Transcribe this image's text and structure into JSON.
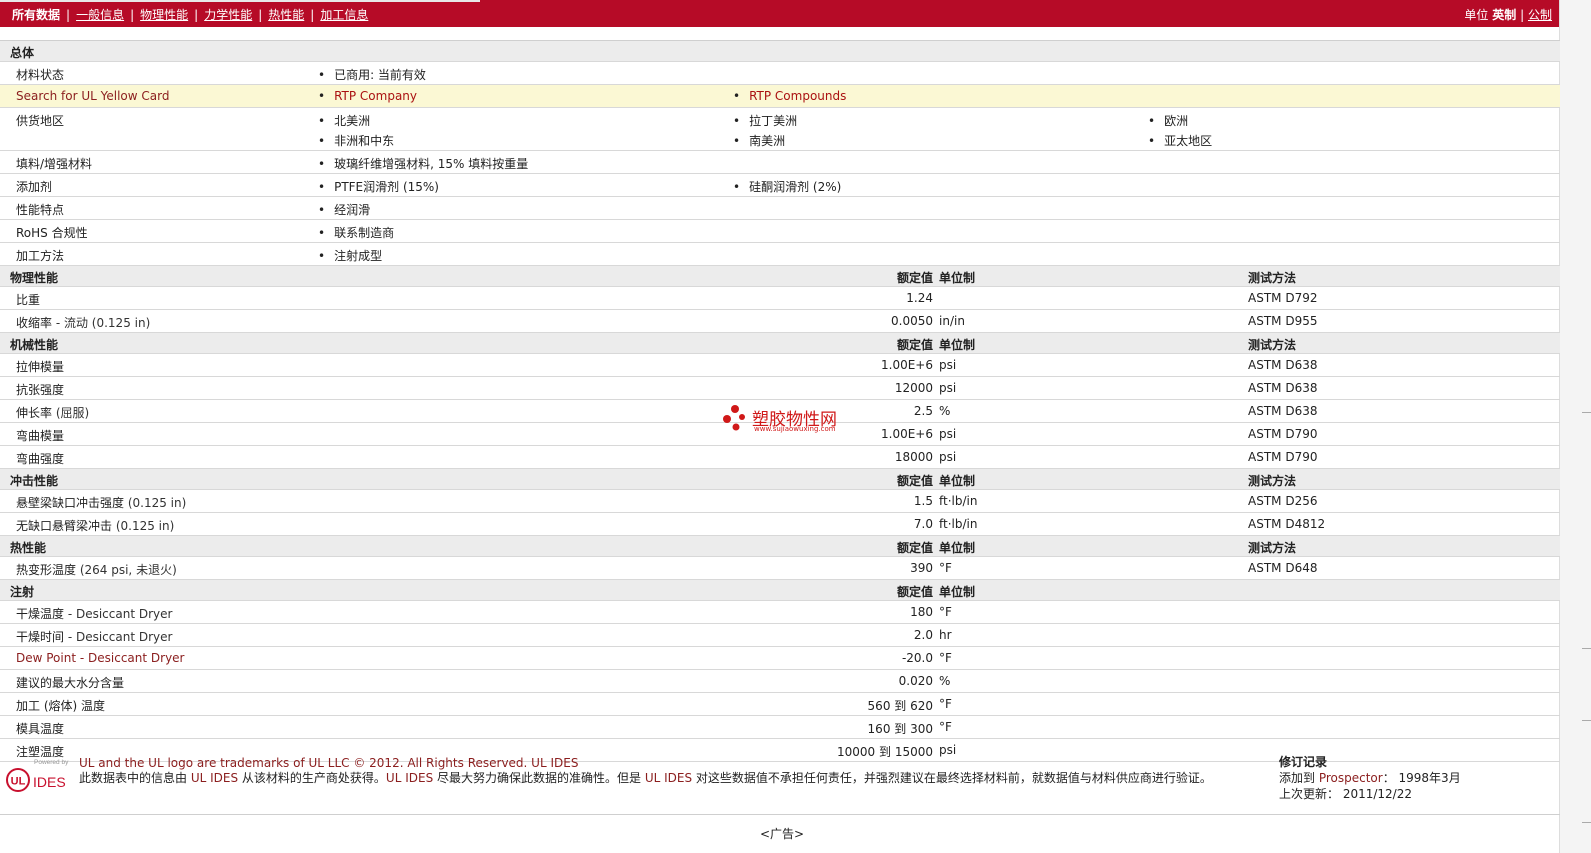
{
  "nav": {
    "all_data": "所有数据",
    "general": "一般信息",
    "physical": "物理性能",
    "mechanical": "力学性能",
    "thermal": "热性能",
    "processing": "加工信息",
    "sep": "|"
  },
  "units": {
    "label": "单位",
    "english": "英制",
    "sep": "|",
    "metric": "公制"
  },
  "general": {
    "title": "总体",
    "material_status_label": "材料状态",
    "material_status_value": "已商用: 当前有效",
    "yellowcard_label": "Search for UL Yellow Card",
    "yellowcard_link1": "RTP Company",
    "yellowcard_link2": "RTP Compounds",
    "supply_label": "供货地区",
    "regions": [
      "北美洲",
      "拉丁美洲",
      "欧洲",
      "非洲和中东",
      "南美洲",
      "亚太地区"
    ],
    "filler_label": "填料/增强材料",
    "filler_value": "玻璃纤维增强材料, 15% 填料按重量",
    "additive_label": "添加剂",
    "additive_1": "PTFE润滑剂 (15%)",
    "additive_2": "硅酮润滑剂 (2%)",
    "features_label": "性能特点",
    "features_value": "经润滑",
    "rohs_label": "RoHS 合规性",
    "rohs_value": "联系制造商",
    "method_label": "加工方法",
    "method_value": "注射成型"
  },
  "headers": {
    "nominal": "额定值",
    "unit": "单位制",
    "test": "测试方法"
  },
  "physical": {
    "title": "物理性能",
    "rows": [
      {
        "label": "比重",
        "note": "",
        "value": "1.24",
        "unit": "",
        "test": "ASTM D792"
      },
      {
        "label": "收缩率",
        "note": " - 流动 (0.125 in)",
        "value": "0.0050",
        "unit": "in/in",
        "test": "ASTM D955"
      }
    ]
  },
  "mechanical": {
    "title": "机械性能",
    "rows": [
      {
        "label": "拉伸模量",
        "note": "",
        "value": "1.00E+6",
        "unit": "psi",
        "test": "ASTM D638"
      },
      {
        "label": "抗张强度",
        "note": "",
        "value": "12000",
        "unit": "psi",
        "test": "ASTM D638"
      },
      {
        "label": "伸长率",
        "note": " (屈服)",
        "value": "2.5",
        "unit": "%",
        "test": "ASTM D638"
      },
      {
        "label": "弯曲模量",
        "note": "",
        "value": "1.00E+6",
        "unit": "psi",
        "test": "ASTM D790"
      },
      {
        "label": "弯曲强度",
        "note": "",
        "value": "18000",
        "unit": "psi",
        "test": "ASTM D790"
      }
    ]
  },
  "impact": {
    "title": "冲击性能",
    "rows": [
      {
        "label": "悬壁梁缺口冲击强度",
        "note": " (0.125 in)",
        "value": "1.5",
        "unit": "ft·lb/in",
        "test": "ASTM D256"
      },
      {
        "label": "无缺口悬臂梁冲击",
        "note": " (0.125 in)",
        "value": "7.0",
        "unit": "ft·lb/in",
        "test": "ASTM D4812"
      }
    ]
  },
  "thermal": {
    "title": "热性能",
    "rows": [
      {
        "label": "热变形温度",
        "note": " (264 psi, 未退火)",
        "value": "390",
        "unit": "°F",
        "test": "ASTM D648"
      }
    ]
  },
  "injection": {
    "title": "注射",
    "rows": [
      {
        "label": "干燥温度",
        "note": " - Desiccant Dryer",
        "value": "180",
        "unit": "°F"
      },
      {
        "label": "干燥时间",
        "note": " - Desiccant Dryer",
        "value": "2.0",
        "unit": "hr"
      },
      {
        "label": "Dew Point - Desiccant Dryer",
        "note": "",
        "value": "-20.0",
        "unit": "°F"
      },
      {
        "label": "建议的最大水分含量",
        "note": "",
        "value": "0.020",
        "unit": "%"
      },
      {
        "label": "加工 (熔体) 温度",
        "note": "",
        "value": "560 到  620",
        "unit": "°F"
      },
      {
        "label": "模具温度",
        "note": "",
        "value": "160 到  300",
        "unit": "°F"
      },
      {
        "label": "注塑温度",
        "note": "",
        "value": "10000 到  15000",
        "unit": "psi"
      }
    ]
  },
  "footer": {
    "powered_by": "Powered by",
    "logo_ul": "UL",
    "logo_ides": "IDES",
    "trademark_a": "UL and the UL logo are trademarks of UL LLC © 2012. All Rights Reserved. ",
    "trademark_b": "UL IDES",
    "disclaimer_a": "此数据表中的信息由 ",
    "disclaimer_b": "UL IDES",
    "disclaimer_c": " 从该材料的生产商处获得。",
    "disclaimer_d": "UL IDES",
    "disclaimer_e": " 尽最大努力确保此数据的准确性。但是 ",
    "disclaimer_f": "UL IDES",
    "disclaimer_g": " 对这些数据值不承担任何责任，并强烈建议在最终选择材料前，就数据值与材料供应商进行验证。",
    "revision_title": "修订记录",
    "added_label": "添加到 ",
    "added_prospector": "Prospector",
    "added_date": "： 1998年3月",
    "updated_label": "上次更新： ",
    "updated_date": "2011/12/22",
    "ad": "<广告>"
  },
  "watermark": {
    "text": "塑胶物性网",
    "url": "www.sujiaowuxing.com"
  }
}
